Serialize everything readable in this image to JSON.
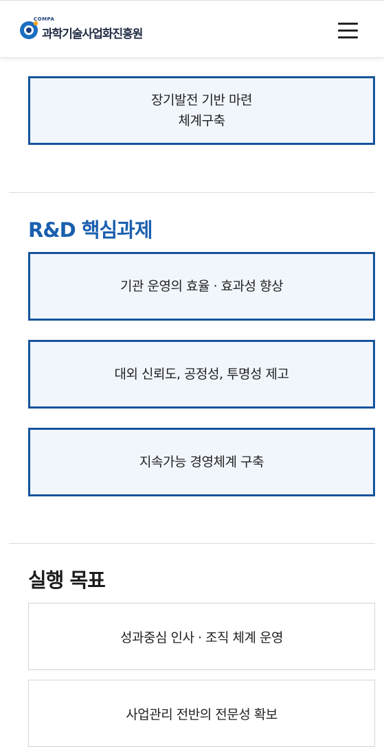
{
  "header": {
    "logo_small": "COMPA",
    "logo_text": "과학기술사업화진흥원",
    "menu_icon": "hamburger-menu-icon"
  },
  "top_box": {
    "line1": "장기발전 기반 마련",
    "line2": "체계구축"
  },
  "rnd_section": {
    "title": "R&D 핵심과제",
    "items": [
      "기관 운영의 효율 · 효과성 향상",
      "대외 신뢰도, 공정성, 투명성 제고",
      "지속가능 경영체계 구축"
    ]
  },
  "goal_section": {
    "title": "실행 목표",
    "items": [
      "성과중심 인사 · 조직 체계 운영",
      "사업관리 전반의 전문성 확보"
    ]
  },
  "colors": {
    "primary_blue": "#15539b",
    "title_blue": "#1a5fae",
    "box_fill": "#f1f6fd"
  }
}
